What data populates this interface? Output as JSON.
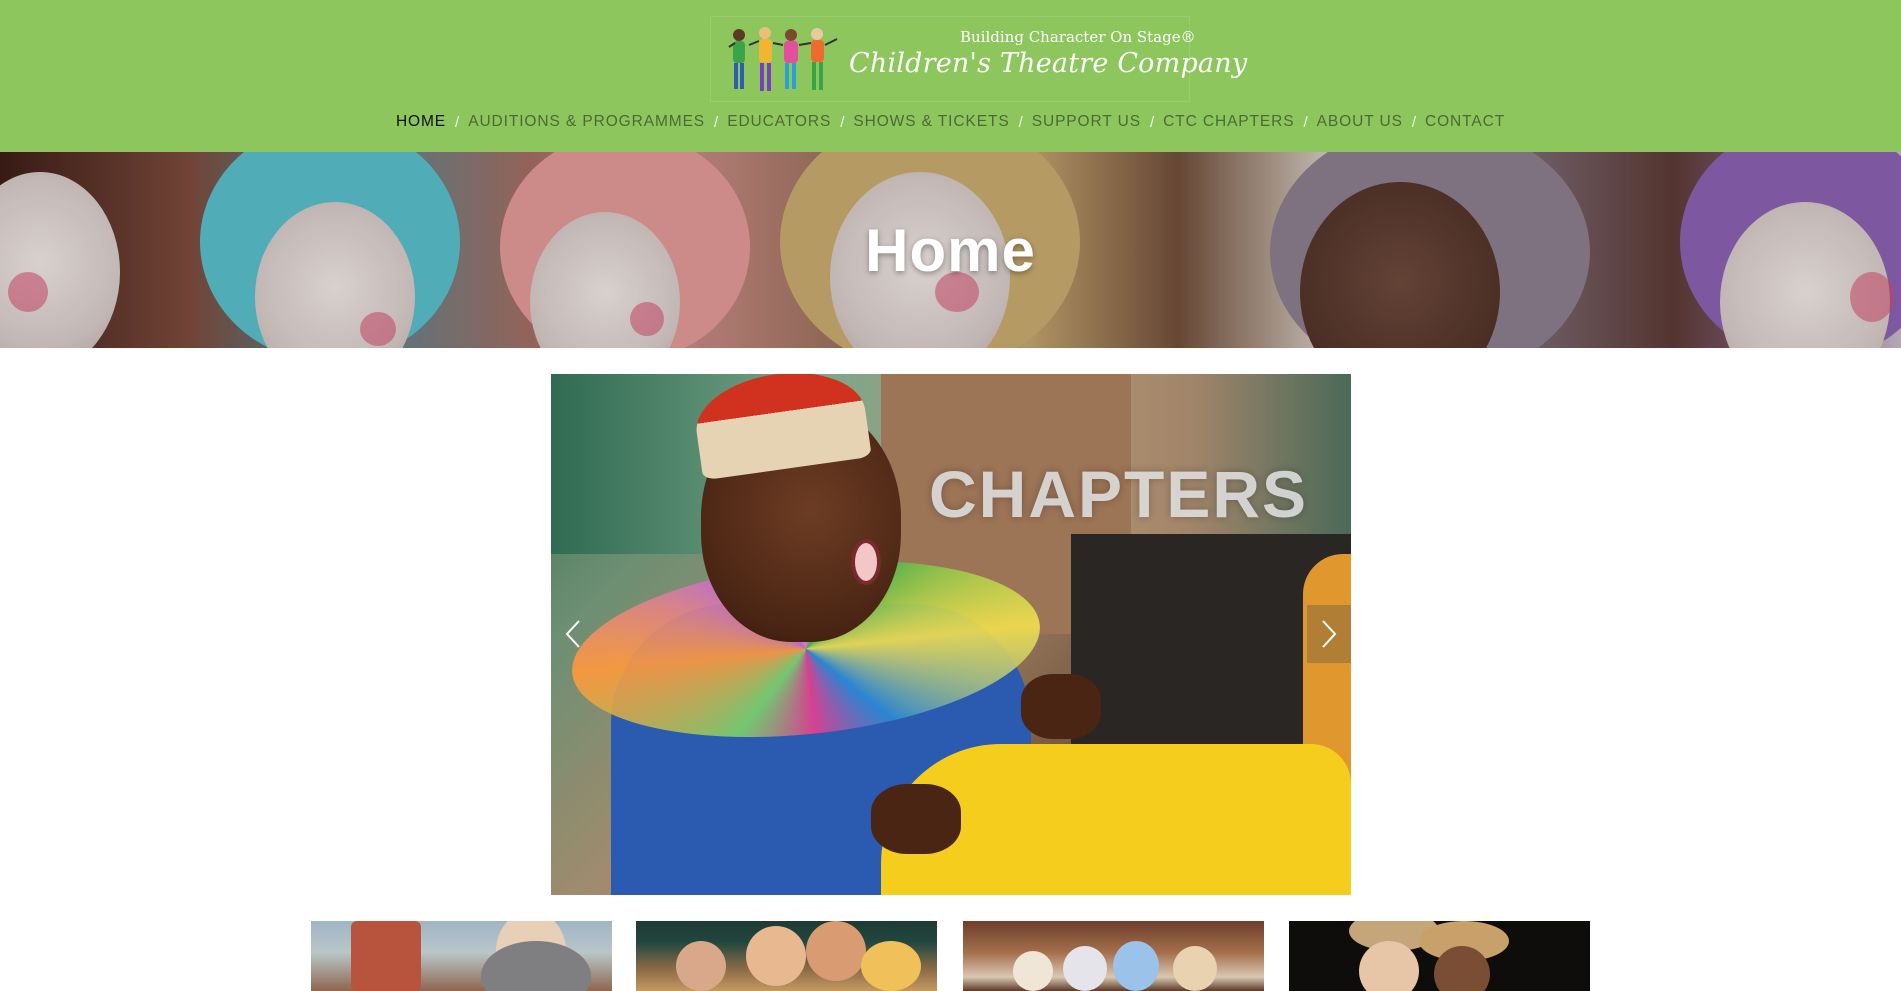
{
  "logo": {
    "tagline": "Building Character On Stage®",
    "name": "Children's Theatre Company"
  },
  "nav": {
    "items": [
      {
        "label": "HOME",
        "active": true
      },
      {
        "label": "AUDITIONS & PROGRAMMES",
        "active": false
      },
      {
        "label": "EDUCATORS",
        "active": false
      },
      {
        "label": "SHOWS & TICKETS",
        "active": false
      },
      {
        "label": "SUPPORT US",
        "active": false
      },
      {
        "label": "CTC CHAPTERS",
        "active": false
      },
      {
        "label": "ABOUT US",
        "active": false
      },
      {
        "label": "CONTACT",
        "active": false
      }
    ],
    "separator": "/"
  },
  "hero": {
    "title": "Home"
  },
  "slider": {
    "slide_title": "CHAPTERS",
    "prev_icon": "chevron-left-icon",
    "next_icon": "chevron-right-icon"
  },
  "colors": {
    "header_bg": "#8cc65c",
    "nav_text": "#4c6a34",
    "nav_active": "#111111"
  }
}
